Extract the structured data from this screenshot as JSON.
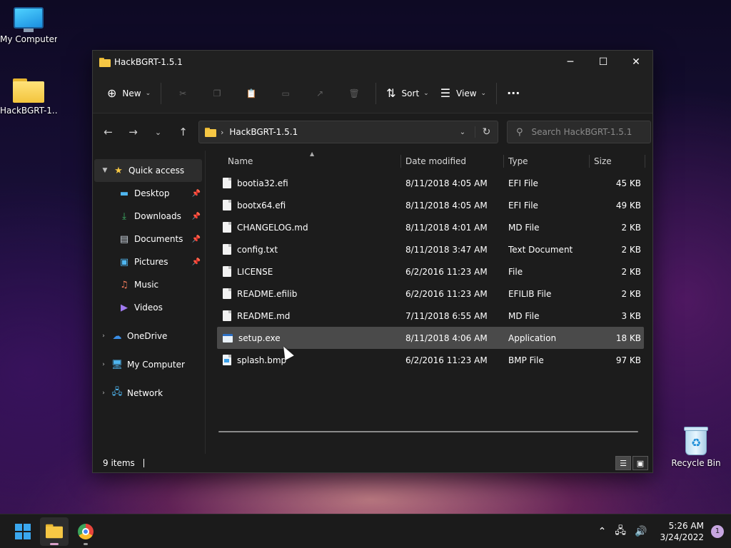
{
  "desktop": {
    "icons": [
      {
        "label": "My Computer"
      },
      {
        "label": "HackBGRT-1..."
      },
      {
        "label": "Recycle Bin"
      }
    ]
  },
  "window": {
    "title": "HackBGRT-1.5.1",
    "controls": {
      "minimize": "─",
      "maximize": "☐",
      "close": "✕"
    },
    "commandbar": {
      "new_label": "New",
      "sort_label": "Sort",
      "view_label": "View",
      "more_label": "···"
    },
    "address": {
      "path": "HackBGRT-1.5.1"
    },
    "search": {
      "placeholder": "Search HackBGRT-1.5.1"
    },
    "nav": {
      "quick_access": "Quick access",
      "pinned": [
        {
          "label": "Desktop",
          "pinned": true
        },
        {
          "label": "Downloads",
          "pinned": true
        },
        {
          "label": "Documents",
          "pinned": true
        },
        {
          "label": "Pictures",
          "pinned": true
        },
        {
          "label": "Music",
          "pinned": false
        },
        {
          "label": "Videos",
          "pinned": false
        }
      ],
      "onedrive": "OneDrive",
      "my_computer": "My Computer",
      "network": "Network"
    },
    "columns": {
      "name": "Name",
      "date": "Date modified",
      "type": "Type",
      "size": "Size"
    },
    "files": [
      {
        "name": "bootia32.efi",
        "date": "8/11/2018 4:05 AM",
        "type": "EFI File",
        "size": "45 KB",
        "icon": "file-icon"
      },
      {
        "name": "bootx64.efi",
        "date": "8/11/2018 4:05 AM",
        "type": "EFI File",
        "size": "49 KB",
        "icon": "file-icon"
      },
      {
        "name": "CHANGELOG.md",
        "date": "8/11/2018 4:01 AM",
        "type": "MD File",
        "size": "2 KB",
        "icon": "file-icon"
      },
      {
        "name": "config.txt",
        "date": "8/11/2018 3:47 AM",
        "type": "Text Document",
        "size": "2 KB",
        "icon": "file-icon"
      },
      {
        "name": "LICENSE",
        "date": "6/2/2016 11:23 AM",
        "type": "File",
        "size": "2 KB",
        "icon": "file-icon"
      },
      {
        "name": "README.efilib",
        "date": "6/2/2016 11:23 AM",
        "type": "EFILIB File",
        "size": "2 KB",
        "icon": "file-icon"
      },
      {
        "name": "README.md",
        "date": "7/11/2018 6:55 AM",
        "type": "MD File",
        "size": "3 KB",
        "icon": "file-icon"
      },
      {
        "name": "setup.exe",
        "date": "8/11/2018 4:06 AM",
        "type": "Application",
        "size": "18 KB",
        "icon": "application-icon",
        "selected": true
      },
      {
        "name": "splash.bmp",
        "date": "6/2/2016 11:23 AM",
        "type": "BMP File",
        "size": "97 KB",
        "icon": "image-file-icon"
      }
    ],
    "status": {
      "items": "9 items"
    }
  },
  "taskbar": {
    "time": "5:26 AM",
    "date": "3/24/2022",
    "notifications": "1"
  }
}
